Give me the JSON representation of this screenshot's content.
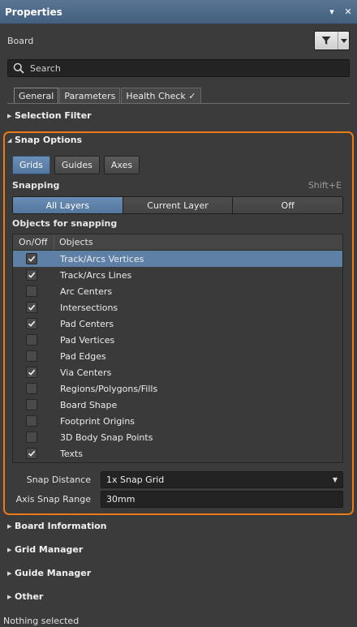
{
  "panel": {
    "title": "Properties",
    "menu_glyph": "▾",
    "close_glyph": "✕"
  },
  "context": {
    "label": "Board",
    "filter_icon": "filter-icon"
  },
  "search": {
    "placeholder": "Search"
  },
  "tabs": [
    {
      "label": "General",
      "active": true
    },
    {
      "label": "Parameters",
      "active": false
    },
    {
      "label": "Health Check ✓",
      "active": false
    }
  ],
  "sections": {
    "selection_filter": "Selection Filter",
    "snap_options": "Snap Options",
    "board_information": "Board Information",
    "grid_manager": "Grid Manager",
    "guide_manager": "Guide Manager",
    "other": "Other"
  },
  "snap": {
    "subtabs": [
      {
        "label": "Grids",
        "active": true
      },
      {
        "label": "Guides",
        "active": false
      },
      {
        "label": "Axes",
        "active": false
      }
    ],
    "snapping_label": "Snapping",
    "snapping_shortcut": "Shift+E",
    "layer_options": [
      {
        "label": "All Layers",
        "active": true
      },
      {
        "label": "Current Layer",
        "active": false
      },
      {
        "label": "Off",
        "active": false
      }
    ],
    "objects_label": "Objects for snapping",
    "columns": {
      "onoff": "On/Off",
      "objects": "Objects"
    },
    "objects": [
      {
        "name": "Track/Arcs Vertices",
        "checked": true,
        "selected": true
      },
      {
        "name": "Track/Arcs Lines",
        "checked": true,
        "selected": false
      },
      {
        "name": "Arc Centers",
        "checked": false,
        "selected": false
      },
      {
        "name": "Intersections",
        "checked": true,
        "selected": false
      },
      {
        "name": "Pad Centers",
        "checked": true,
        "selected": false
      },
      {
        "name": "Pad Vertices",
        "checked": false,
        "selected": false
      },
      {
        "name": "Pad Edges",
        "checked": false,
        "selected": false
      },
      {
        "name": "Via Centers",
        "checked": true,
        "selected": false
      },
      {
        "name": "Regions/Polygons/Fills",
        "checked": false,
        "selected": false
      },
      {
        "name": "Board Shape",
        "checked": false,
        "selected": false
      },
      {
        "name": "Footprint Origins",
        "checked": false,
        "selected": false
      },
      {
        "name": "3D Body Snap Points",
        "checked": false,
        "selected": false
      },
      {
        "name": "Texts",
        "checked": true,
        "selected": false
      }
    ],
    "snap_distance_label": "Snap Distance",
    "snap_distance_value": "1x Snap Grid",
    "axis_snap_label": "Axis Snap Range",
    "axis_snap_value": "30mm"
  },
  "status": "Nothing selected",
  "colors": {
    "accent": "#ea7b16",
    "selection": "#5e7fa6",
    "titlebar": "#4f6b8b"
  }
}
